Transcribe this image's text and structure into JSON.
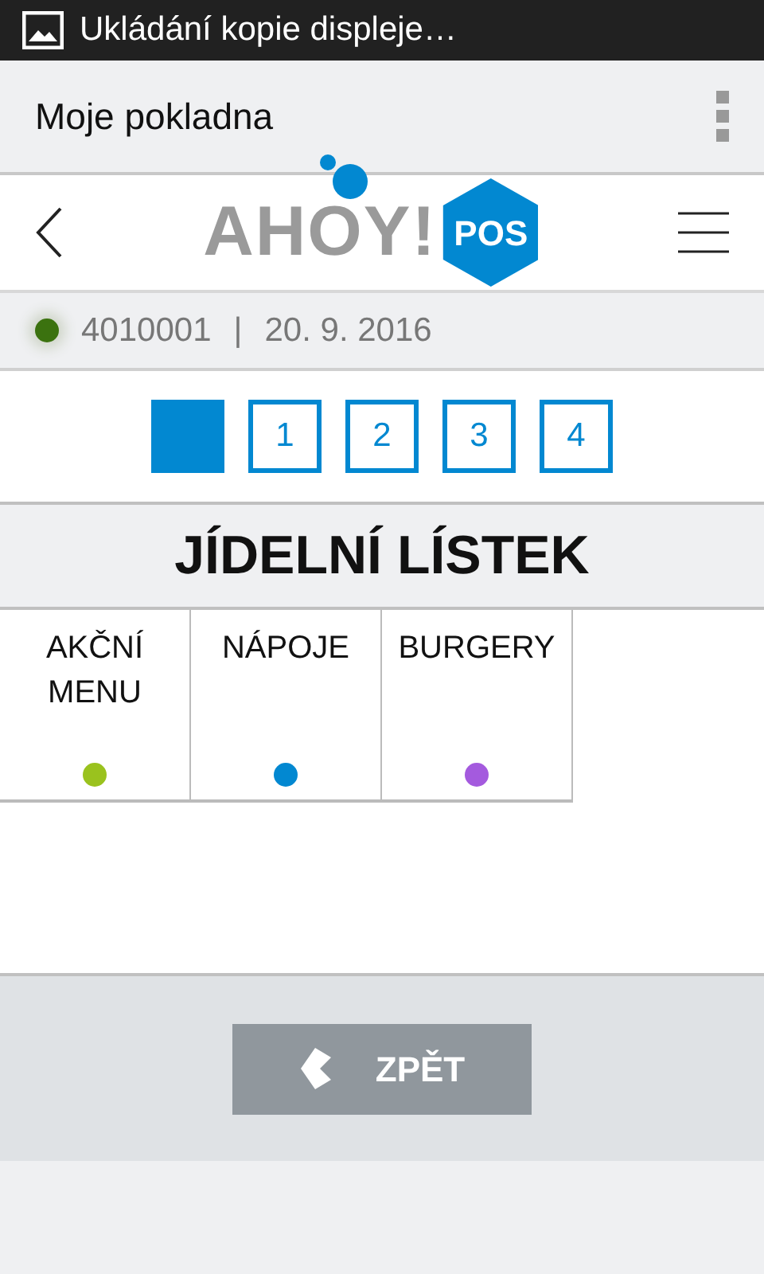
{
  "status_bar": {
    "notification": "Ukládání kopie displeje…"
  },
  "app_bar": {
    "title": "Moje pokladna"
  },
  "header": {
    "logo_text": "AHOY!",
    "logo_badge": "POS"
  },
  "info": {
    "online": true,
    "register": "4010001",
    "separator": "|",
    "date": "20. 9. 2016"
  },
  "pages": [
    {
      "selected": true
    },
    {
      "label": "1",
      "selected": false
    },
    {
      "label": "2",
      "selected": false
    },
    {
      "label": "3",
      "selected": false
    },
    {
      "label": "4",
      "selected": false
    }
  ],
  "section_title": "JÍDELNÍ LÍSTEK",
  "categories": [
    {
      "name": "AKČNÍ MENU",
      "color": "#9ac21e"
    },
    {
      "name": "NÁPOJE",
      "color": "#0288d1"
    },
    {
      "name": "BURGERY",
      "color": "#a45ade"
    }
  ],
  "back_button": {
    "label": "ZPĚT"
  }
}
